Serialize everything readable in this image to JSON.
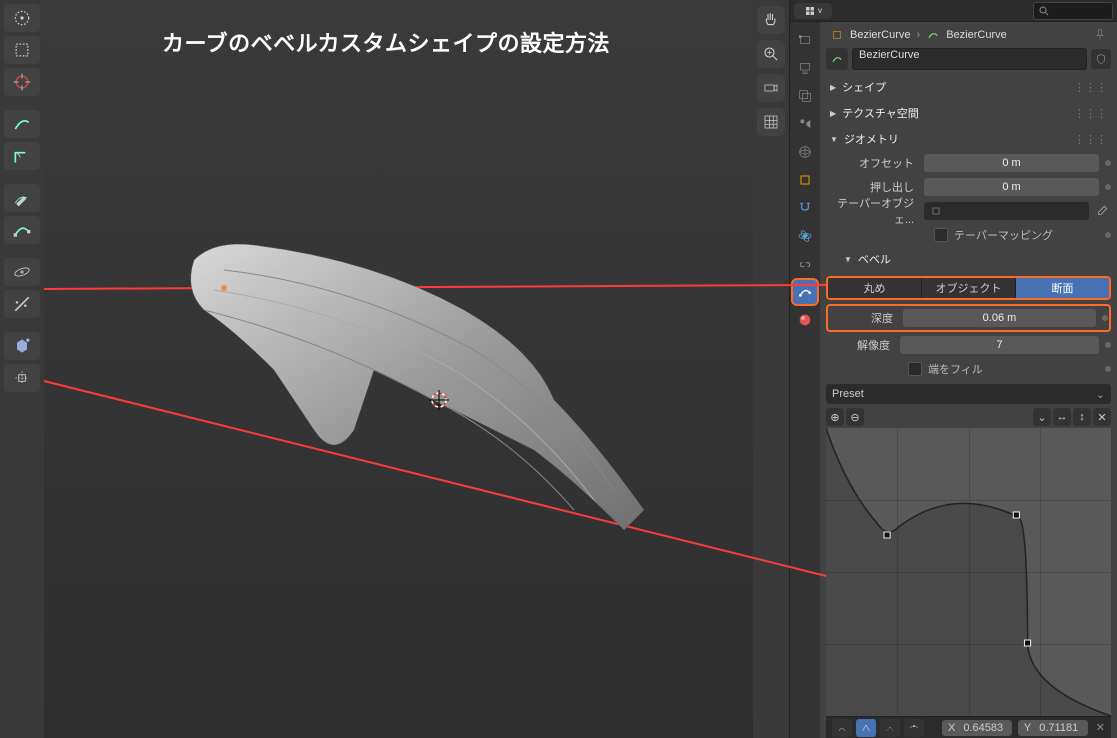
{
  "title_overlay": "カーブのベベルカスタムシェイプの設定方法",
  "breadcrumb": {
    "item1": "BezierCurve",
    "item2": "BezierCurve"
  },
  "object_name": "BezierCurve",
  "sections": {
    "shape": "シェイプ",
    "texture_space": "テクスチャ空間",
    "geometry": "ジオメトリ",
    "bevel": "ベベル"
  },
  "geometry": {
    "offset_label": "オフセット",
    "offset_value": "0 m",
    "extrude_label": "押し出し",
    "extrude_value": "0 m",
    "taper_label": "テーパーオブジェ...",
    "taper_placeholder": "",
    "taper_mapping_label": "テーパーマッピング"
  },
  "bevel": {
    "mode_round": "丸め",
    "mode_object": "オブジェクト",
    "mode_profile": "断面",
    "depth_label": "深度",
    "depth_value": "0.06 m",
    "resolution_label": "解像度",
    "resolution_value": "7",
    "fill_caps_label": "端をフィル",
    "preset_label": "Preset"
  },
  "footer": {
    "x_label": "X",
    "x_value": "0.64583",
    "y_label": "Y",
    "y_value": "0.71181"
  }
}
